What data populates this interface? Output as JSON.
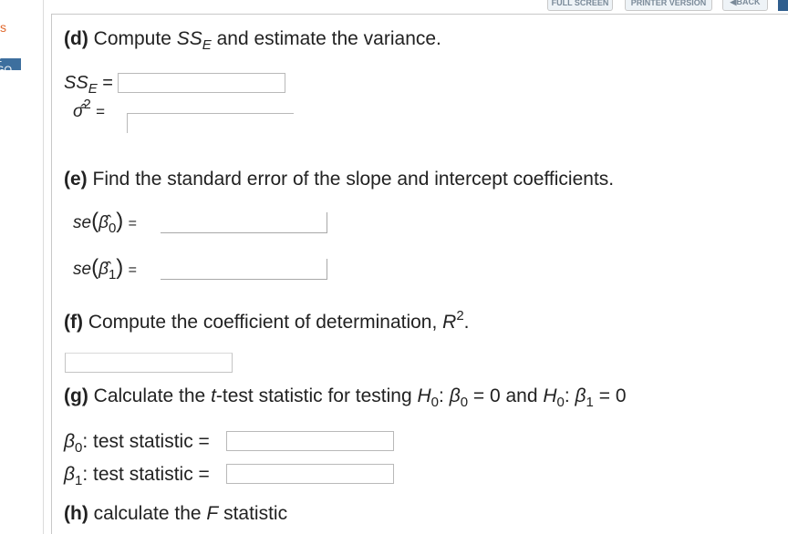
{
  "toolbar": {
    "full_screen": "FULL SCREEN",
    "printer_version": "PRINTER VERSION",
    "back": "◀BACK"
  },
  "sidebar": {
    "s_char": "s",
    "go": "2 GO"
  },
  "d": {
    "letter": "(d)",
    "text_before": " Compute ",
    "sym": "SS",
    "sub": "E",
    "text_after": " and estimate the variance.",
    "sse_label": "SS",
    "sse_sub": "E",
    "eq": " =",
    "sigma": "σ̂",
    "sigma_sup": "2",
    "sigma_eq": "="
  },
  "e": {
    "letter": "(e)",
    "text": " Find the standard error of the slope and intercept coefficients.",
    "se": "se",
    "b0": "β̂",
    "b0_sub": "0",
    "b1": "β̂",
    "b1_sub": "1",
    "eq": "="
  },
  "f": {
    "letter": "(f)",
    "text": " Compute the coefficient of determination, ",
    "r": "R",
    "r_sup": "2",
    "period": "."
  },
  "g": {
    "letter": "(g)",
    "text_before": " Calculate the ",
    "t": "t",
    "text_mid": "-test statistic for testing ",
    "h": "H",
    "h_sub": "0",
    "colon": ": ",
    "beta": "β",
    "b0_sub": "0",
    "eq_zero": " = 0 and ",
    "b1_sub": "1",
    "end_zero": " = 0",
    "beta0_label": "β",
    "beta0_sub": "0",
    "beta0_text": ": test statistic =",
    "beta1_label": "β",
    "beta1_sub": "1",
    "beta1_text": ": test statistic ="
  },
  "h": {
    "letter": "(h)",
    "text_before": " calculate the ",
    "f": "F",
    "text_after": " statistic"
  }
}
